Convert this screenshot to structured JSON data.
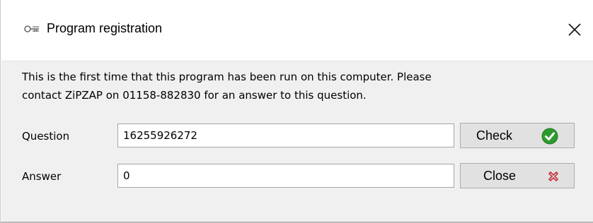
{
  "window": {
    "title": "Program registration",
    "title_icon": "key-icon",
    "close_icon": "close-icon"
  },
  "dialog": {
    "message_line1": "This is the first time that this program has been run on this computer. Please",
    "message_line2": "contact ZiPZAP on 01158-882830 for an answer to this question."
  },
  "form": {
    "question_label": "Question",
    "question_value": "16255926272",
    "answer_label": "Answer",
    "answer_value": "0"
  },
  "buttons": {
    "check_label": "Check",
    "check_icon": "checkmark-icon",
    "close_label": "Close",
    "close_icon": "close-x-icon"
  },
  "colors": {
    "check_green": "#2e9a2e",
    "close_red": "#c8303c",
    "client_bg": "#f0f0f0"
  }
}
